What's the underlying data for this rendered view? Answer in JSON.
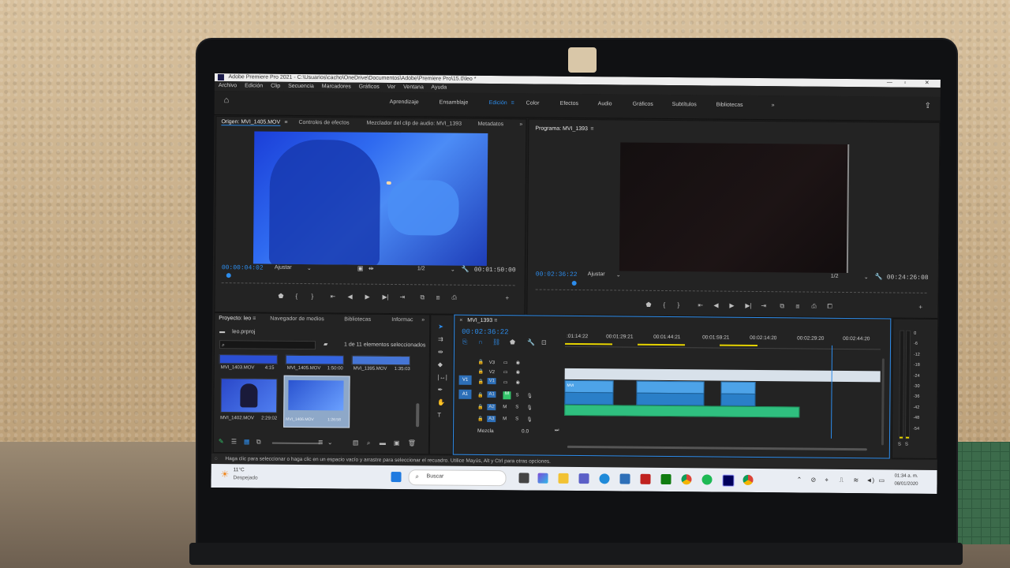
{
  "window": {
    "title": "Adobe Premiere Pro 2021 - C:\\Usuarios\\cacho\\OneDrive\\Documentos\\Adobe\\Premiere Pro\\15.0\\leo *"
  },
  "menu": [
    "Archivo",
    "Edición",
    "Clip",
    "Secuencia",
    "Marcadores",
    "Gráficos",
    "Ver",
    "Ventana",
    "Ayuda"
  ],
  "workspaces": [
    "Aprendizaje",
    "Ensamblaje",
    "Edición",
    "Color",
    "Efectos",
    "Audio",
    "Gráficos",
    "Subtítulos",
    "Bibliotecas"
  ],
  "source_panel": {
    "tabs": [
      "Origen: MVI_1405.MOV",
      "Controles de efectos",
      "Mezclador del clip de audio: MVI_1393",
      "Metadatos"
    ],
    "timecode": "00:00:04:02",
    "fit": "Ajustar",
    "resolution": "1/2",
    "duration": "00:01:50:00"
  },
  "program_panel": {
    "tab": "Programa: MVI_1393",
    "timecode": "00:02:36:22",
    "fit": "Ajustar",
    "resolution": "1/2",
    "duration": "00:24:26:08"
  },
  "project_panel": {
    "tabs": [
      "Proyecto: leo",
      "Navegador de medios",
      "Bibliotecas",
      "Informac"
    ],
    "file": "leo.prproj",
    "selection": "1 de 11 elementos seleccionados",
    "items": [
      {
        "name": "MVI_1403.MOV",
        "duration": "4:15"
      },
      {
        "name": "MVI_1405.MOV",
        "duration": "1:50:00"
      },
      {
        "name": "MVI_1395.MOV",
        "duration": "1:35:03"
      },
      {
        "name": "MVI_1402.MOV",
        "duration": "2:29:02"
      },
      {
        "name": "MVI_1406.MOV",
        "duration": "1:26:58"
      }
    ]
  },
  "timeline": {
    "tab": "MVI_1393",
    "timecode": "00:02:36:22",
    "ruler": [
      ":01:14:22",
      "00:01:29:21",
      "00:01:44:21",
      "00:01:59:21",
      "00:02:14:20",
      "00:02:29:20",
      "00:02:44:20"
    ],
    "video_tracks": [
      "V3",
      "V2",
      "V1"
    ],
    "audio_tracks": [
      "A1",
      "A2",
      "A3"
    ],
    "src_v": "V1",
    "src_a": "A1",
    "mix_label": "Mezcla",
    "mix_value": "0.0",
    "clip_label": "MVI"
  },
  "meter": {
    "scale": [
      "0",
      "-6",
      "-12",
      "-18",
      "-24",
      "-30",
      "-36",
      "-42",
      "-48",
      "-54"
    ],
    "solo": "S"
  },
  "status": "Haga clic para seleccionar o haga clic en un espacio vacío y arrastre para seleccionar el recuadro. Utilice Mayús, Alt y Ctrl para otras opciones.",
  "taskbar": {
    "weather_temp": "11°C",
    "weather_desc": "Despejado",
    "search": "Buscar",
    "time": "01:34 a. m.",
    "date": "08/01/2020"
  },
  "colors": {
    "accent": "#2d8ceb",
    "audio_clip": "#2fbf7f",
    "video_clip": "#4da3e8"
  }
}
